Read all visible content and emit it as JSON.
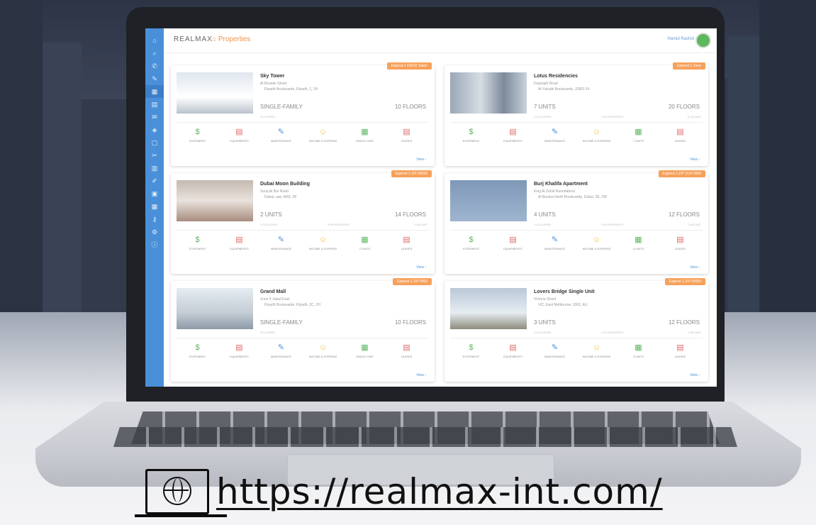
{
  "app": {
    "brand": "REALMAX",
    "breadcrumb": "Properties",
    "user": "Hamid Rashid"
  },
  "sidebar_icons": [
    "home-icon",
    "search-icon",
    "phone-icon",
    "edit-icon",
    "building-icon",
    "file-icon",
    "mail-icon",
    "tag-icon",
    "doc-icon",
    "tool-icon",
    "chart-icon",
    "pen-icon",
    "calendar-icon",
    "grid-icon",
    "key-icon",
    "gear-icon",
    "info-icon"
  ],
  "action_labels": {
    "statement": "STATEMENT",
    "equipments": "EQUIPMENTS",
    "maintenance": "MAINTENANCE",
    "income_expense": "INCOME & EXPENSE",
    "single_unit": "SINGLE UNIT",
    "units7": "7 UNITS",
    "units2": "2 UNITS",
    "units4": "4 UNITS",
    "units3": "3 UNITS",
    "leases": "LEASES"
  },
  "properties": [
    {
      "title": "Sky Tower",
      "addr1": "Al Boraiek Street",
      "addr2": "Riyadh Boulevarde, Riyadh, 1, 2H",
      "badge": "Expired 1 KMTD Tower",
      "unit_type": "SINGLE-FAMILY",
      "floors": "10 FLOORS",
      "meta": [
        "OCCUPIED",
        "",
        ""
      ],
      "units_label": "SINGLE UNIT",
      "view": "View"
    },
    {
      "title": "Lotus Residencies",
      "addr1": "Duqaqah Road",
      "addr2": "Al-Yaloubi Boulevarde, JOBS-24",
      "badge": "Expired 1 Zone",
      "unit_type": "7 UNITS",
      "floors": "20 FLOORS",
      "meta": [
        "0 OCCUPIED",
        "0 IN PROGRESS",
        "6 VACANT"
      ],
      "units_label": "7 UNITS",
      "view": "View"
    },
    {
      "title": "Dubai Moon Building",
      "addr1": "Souq Al Bur Road",
      "addr2": "Dubai, uae, ARE, 85",
      "badge": "Expired 1 ZIP 00030",
      "unit_type": "2 UNITS",
      "floors": "14 FLOORS",
      "meta": [
        "0 OCCUPIED",
        "0 IN PROGRESS",
        "0 VACANT"
      ],
      "units_label": "2 UNITS",
      "view": "View"
    },
    {
      "title": "Burj Khalifa Apartment",
      "addr1": "King Al Zahid Roundabout",
      "addr2": "Al Barsha North Boulevarde, Dubai, 2E, 2W",
      "badge": "Expired 1 ZIP 1110 0000",
      "unit_type": "4 UNITS",
      "floors": "12 FLOORS",
      "meta": [
        "0 OCCUPIED",
        "0 IN PROGRESS",
        "2 VACANT"
      ],
      "units_label": "4 UNITS",
      "view": "View"
    },
    {
      "title": "Grand Mall",
      "addr1": "Zone 9 Jabal Ezan",
      "addr2": "Riyadh Boulevarde, Riyadh, 2C, 2H",
      "badge": "Expired 1 ZIP 0000",
      "unit_type": "SINGLE-FAMILY",
      "floors": "10 FLOORS",
      "meta": [
        "OCCUPIED",
        "",
        ""
      ],
      "units_label": "SINGLE UNIT",
      "view": "View"
    },
    {
      "title": "Lovers Bridge Single Unit",
      "addr1": "Victoria Street",
      "addr2": "VIC, East Melbourne, 3002, AU",
      "badge": "Expired 1 ZIP 00000",
      "unit_type": "3 UNITS",
      "floors": "12 FLOORS",
      "meta": [
        "0 OCCUPIED",
        "0 IN PROGRESS",
        "2 VACANT"
      ],
      "units_label": "3 UNITS",
      "view": "View"
    }
  ],
  "colors": {
    "accent": "#4a90d9",
    "orange": "#f6a15b",
    "green": "#5cb85c",
    "red": "#e06a6a",
    "yellow": "#f0c040"
  },
  "footer": {
    "url": "https://realmax-int.com/"
  }
}
